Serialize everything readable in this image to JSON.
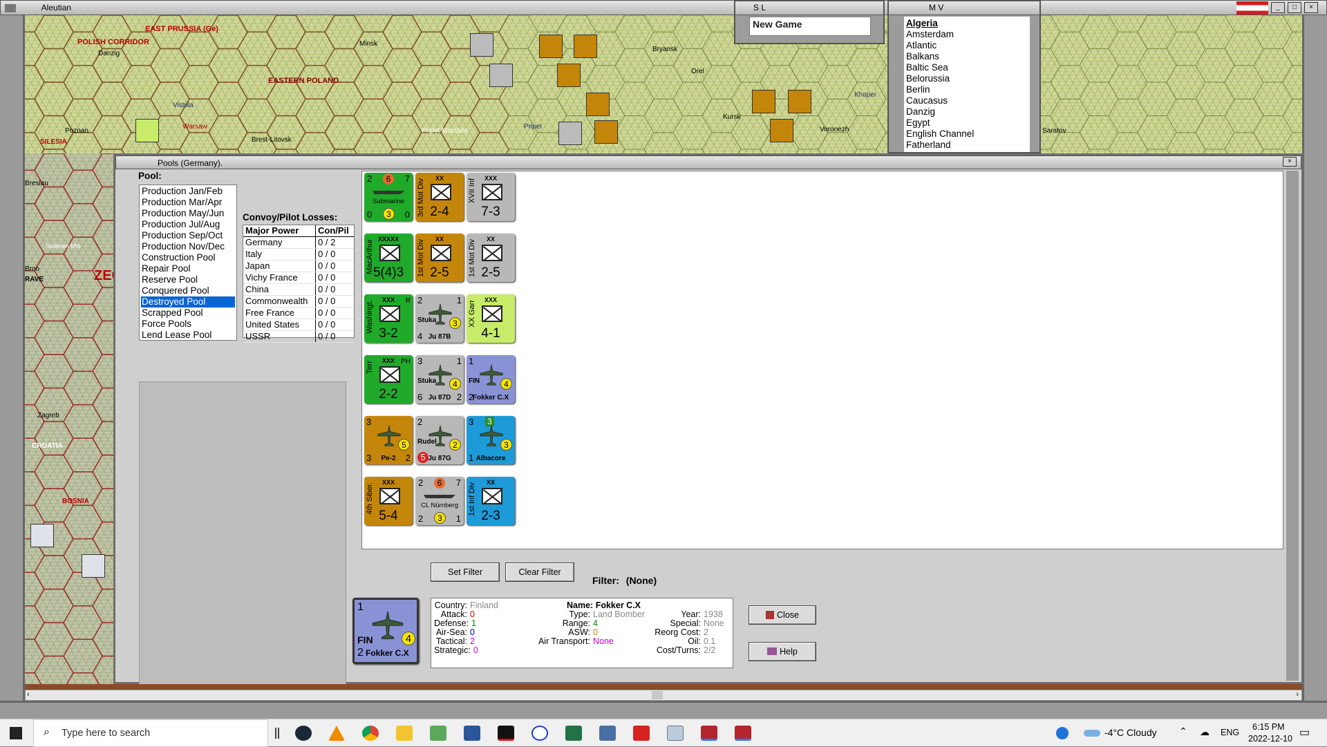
{
  "main_window": {
    "title": "Aleutian"
  },
  "map_labels": [
    "EAST PRUSSIA (Ge)",
    "POLISH CORRIDOR",
    "Danzig",
    "Minsk",
    "Bryansk",
    "EASTERN POLAND",
    "Orel",
    "Khoper",
    "Vistula",
    "Poznan",
    "Warsaw",
    "Brest-Litovsk",
    "Pripet Marshes",
    "Pripet",
    "Kursk",
    "Voronezh",
    "Saratov",
    "SILESIA",
    "Breslau",
    "Sudeten Mts",
    "Brno",
    "RAVE",
    "ZECH",
    "Zagreb",
    "CROATIA",
    "BOSNIA"
  ],
  "sl_panel": {
    "title": "S L",
    "item": "New Game"
  },
  "mv_panel": {
    "title": "M V",
    "items": [
      "Algeria",
      "Amsterdam",
      "Atlantic",
      "Balkans",
      "Baltic Sea",
      "Belorussia",
      "Berlin",
      "Caucasus",
      "Danzig",
      "Egypt",
      "English Channel",
      "Fatherland"
    ]
  },
  "pools_window": {
    "title": "Pools (Germany).",
    "pool_label": "Pool:",
    "pools": [
      "Production Jan/Feb",
      "Production Mar/Apr",
      "Production May/Jun",
      "Production Jul/Aug",
      "Production Sep/Oct",
      "Production Nov/Dec",
      "Construction Pool",
      "Repair Pool",
      "Reserve Pool",
      "Conquered Pool",
      "Destroyed Pool",
      "Scrapped Pool",
      "Force Pools",
      "Lend Lease Pool"
    ],
    "selected_pool": "Destroyed Pool",
    "losses_label": "Convoy/Pilot Losses:",
    "losses_headers": [
      "Major Power",
      "Con/Pil"
    ],
    "losses": [
      {
        "power": "Germany",
        "value": "0 / 2"
      },
      {
        "power": "Italy",
        "value": "0 / 0"
      },
      {
        "power": "Japan",
        "value": "0 / 0"
      },
      {
        "power": "Vichy France",
        "value": "0 / 0"
      },
      {
        "power": "China",
        "value": "0 / 0"
      },
      {
        "power": "Commonwealth",
        "value": "0 / 0"
      },
      {
        "power": "Free France",
        "value": "0 / 0"
      },
      {
        "power": "United States",
        "value": "0 / 0"
      },
      {
        "power": "USSR",
        "value": "0 / 0"
      }
    ],
    "set_filter": "Set Filter",
    "clear_filter": "Clear Filter",
    "filter_label": "Filter:",
    "filter_value": "(None)",
    "close": "Close",
    "help": "Help"
  },
  "counters": [
    [
      {
        "color": "#1faa2a",
        "type": "naval",
        "tl": "2",
        "tm": "6",
        "tr": "7",
        "name": "Submarine",
        "bl": "0",
        "bm": "3",
        "br": "0"
      },
      {
        "color": "#c4860a",
        "type": "land",
        "size": "XX",
        "vlabel": "3rd Mot Div",
        "value": "2-4"
      },
      {
        "color": "#b8b8b8",
        "type": "land",
        "size": "XXX",
        "vlabel": "XVII Inf",
        "value": "7-3"
      }
    ],
    [
      {
        "color": "#1faa2a",
        "type": "land",
        "size": "XXXXX",
        "vlabel": "MacArthur",
        "value": "5(4)3"
      },
      {
        "color": "#c4860a",
        "type": "land",
        "size": "XX",
        "vlabel": "1st Mot Div",
        "value": "2-5"
      },
      {
        "color": "#b8b8b8",
        "type": "land",
        "size": "XX",
        "vlabel": "1st Mot Div",
        "value": "2-5"
      }
    ],
    [
      {
        "color": "#1faa2a",
        "type": "land",
        "size": "XXX",
        "vlabel": "Washingt.",
        "value": "3-2",
        "extra": "R"
      },
      {
        "color": "#b8b8b8",
        "type": "air",
        "tl": "2",
        "tr": "1",
        "name": "Stuka",
        "circle": "3",
        "bl": "4",
        "label": "Ju 87B"
      },
      {
        "color": "#c8ec6a",
        "type": "land",
        "size": "XXX",
        "vlabel": "XX Garr",
        "value": "4-1"
      }
    ],
    [
      {
        "color": "#1faa2a",
        "type": "land",
        "size": "XXX",
        "vlabel": "Terr",
        "value": "2-2",
        "extra": "PH"
      },
      {
        "color": "#b8b8b8",
        "type": "air",
        "tl": "3",
        "tr": "1",
        "name": "Stuka",
        "circle": "4",
        "bl": "6",
        "label": "Ju 87D",
        "br": "2"
      },
      {
        "color": "#8a92d6",
        "type": "air",
        "tl": "1",
        "name": "FIN",
        "circle": "4",
        "bl": "2",
        "label": "Fokker C.X"
      }
    ],
    [
      {
        "color": "#c4860a",
        "type": "air",
        "tl": "3",
        "circle": "5",
        "bl": "3",
        "label": "Pe-2",
        "br": "2"
      },
      {
        "color": "#b8b8b8",
        "type": "air",
        "tl": "2",
        "name": "Rudel",
        "circle": "2",
        "bl": "5",
        "label": "Ju 87G"
      },
      {
        "color": "#1d9ad8",
        "type": "air",
        "tl": "3",
        "tm": "3",
        "circle": "3",
        "bl": "1",
        "label": "Albacore"
      }
    ],
    [
      {
        "color": "#c4860a",
        "type": "land",
        "size": "XXX",
        "vlabel": "4th Siber.",
        "value": "5-4"
      },
      {
        "color": "#b8b8b8",
        "type": "naval",
        "tl": "2",
        "tm": "6",
        "tr": "7",
        "name": "CL Nürnberg",
        "bl": "2",
        "bm": "3",
        "br": "1"
      },
      {
        "color": "#1d9ad8",
        "type": "land",
        "size": "XX",
        "vlabel": "1st Inf Div",
        "value": "2-3"
      }
    ]
  ],
  "selected_unit": {
    "counter": {
      "tl": "1",
      "name": "FIN",
      "circle": "4",
      "bl": "2",
      "label": "Fokker C.X"
    },
    "col1": [
      {
        "k": "Country:",
        "v": "Finland",
        "c": "#888"
      },
      {
        "k": "Attack:",
        "v": "0",
        "c": "#d00"
      },
      {
        "k": "Defense:",
        "v": "1",
        "c": "#080"
      },
      {
        "k": "Air-Sea:",
        "v": "0",
        "c": "#00c"
      },
      {
        "k": "Tactical:",
        "v": "2",
        "c": "#c0c"
      },
      {
        "k": "Strategic:",
        "v": "0",
        "c": "#c0c"
      }
    ],
    "name_label": "Name:",
    "name": "Fokker C.X",
    "col2": [
      {
        "k": "Type:",
        "v": "Land Bomber",
        "c": "#888"
      },
      {
        "k": "Range:",
        "v": "4",
        "c": "#080"
      },
      {
        "k": "ASW:",
        "v": "0",
        "c": "#c80"
      },
      {
        "k": "Air Transport:",
        "v": "None",
        "c": "#c0c"
      }
    ],
    "col3": [
      {
        "k": "Year:",
        "v": "1938"
      },
      {
        "k": "Special:",
        "v": "None"
      },
      {
        "k": "Reorg Cost:",
        "v": "2"
      },
      {
        "k": "Oil:",
        "v": "0.1"
      },
      {
        "k": "Cost/Turns:",
        "v": "2/2"
      }
    ]
  },
  "taskbar": {
    "search_placeholder": "Type here to search",
    "weather": "-4°C  Cloudy",
    "lang": "ENG",
    "time": "6:15 PM",
    "date": "2022-12-10"
  }
}
